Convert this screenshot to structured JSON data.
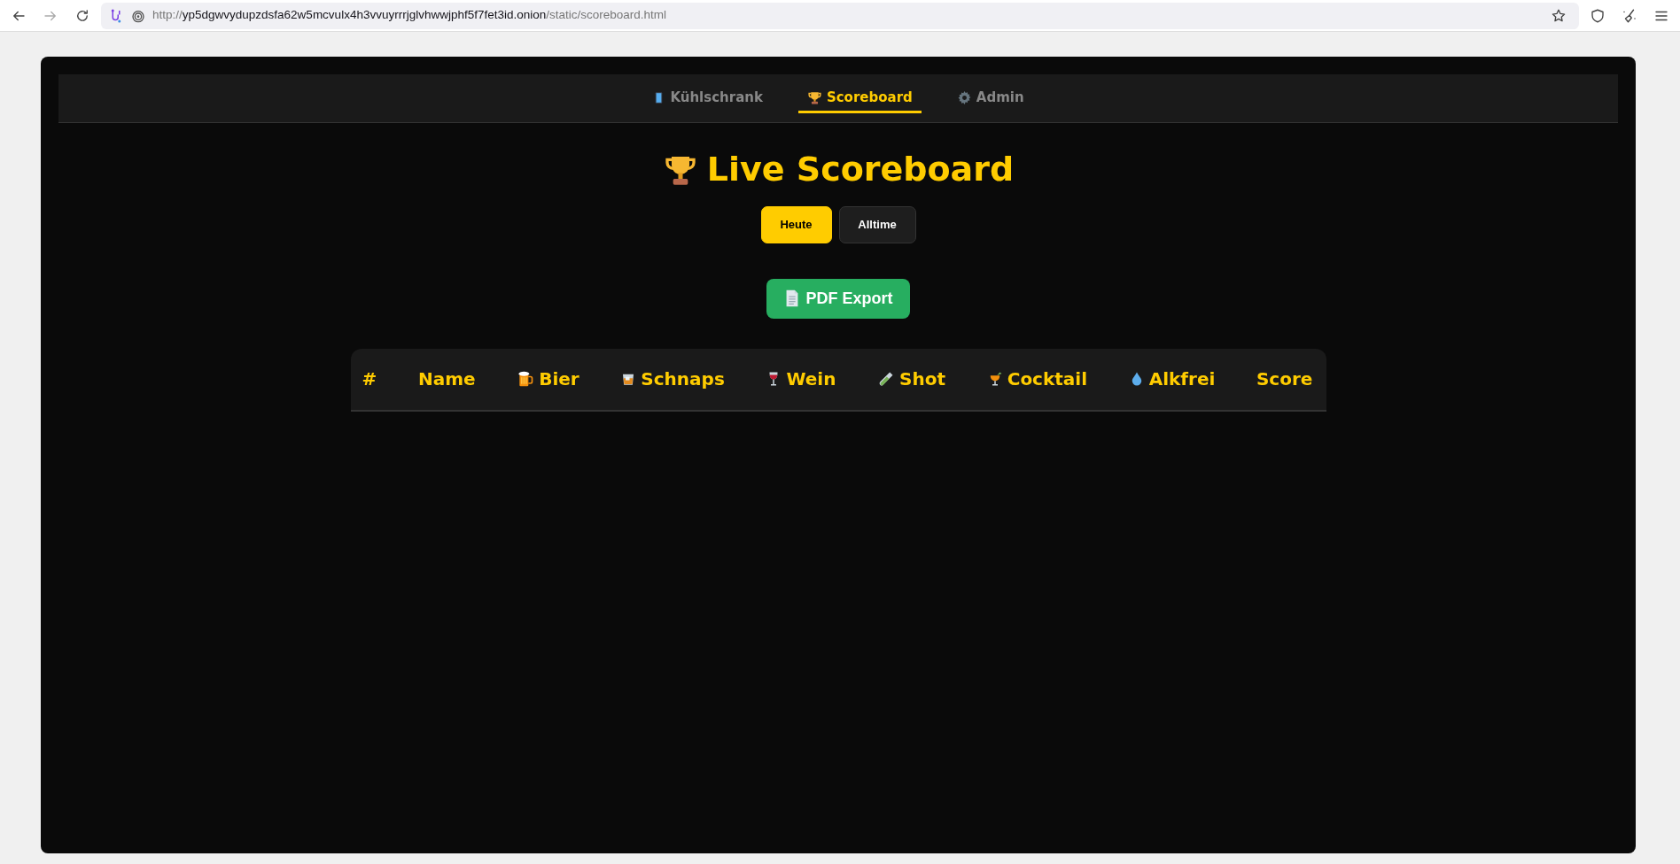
{
  "browser": {
    "url": {
      "scheme": "http://",
      "host": "yp5dgwvydupzdsfa62w5mcvulx4h3vvuyrrrjglvhwwjphf5f7fet3id.onion",
      "path": "/static/scoreboard.html"
    }
  },
  "nav": [
    {
      "label": "Kühlschrank",
      "selected": false
    },
    {
      "label": "Scoreboard",
      "selected": true
    },
    {
      "label": "Admin",
      "selected": false
    }
  ],
  "title": "Live Scoreboard",
  "period_buttons": [
    {
      "label": "Heute",
      "selected": true
    },
    {
      "label": "Alltime",
      "selected": false
    }
  ],
  "export_button": "PDF Export",
  "table": {
    "columns": [
      "#",
      "Name",
      "Bier",
      "Schnaps",
      "Wein",
      "Shot",
      "Cocktail",
      "Alkfrei",
      "Score"
    ]
  }
}
